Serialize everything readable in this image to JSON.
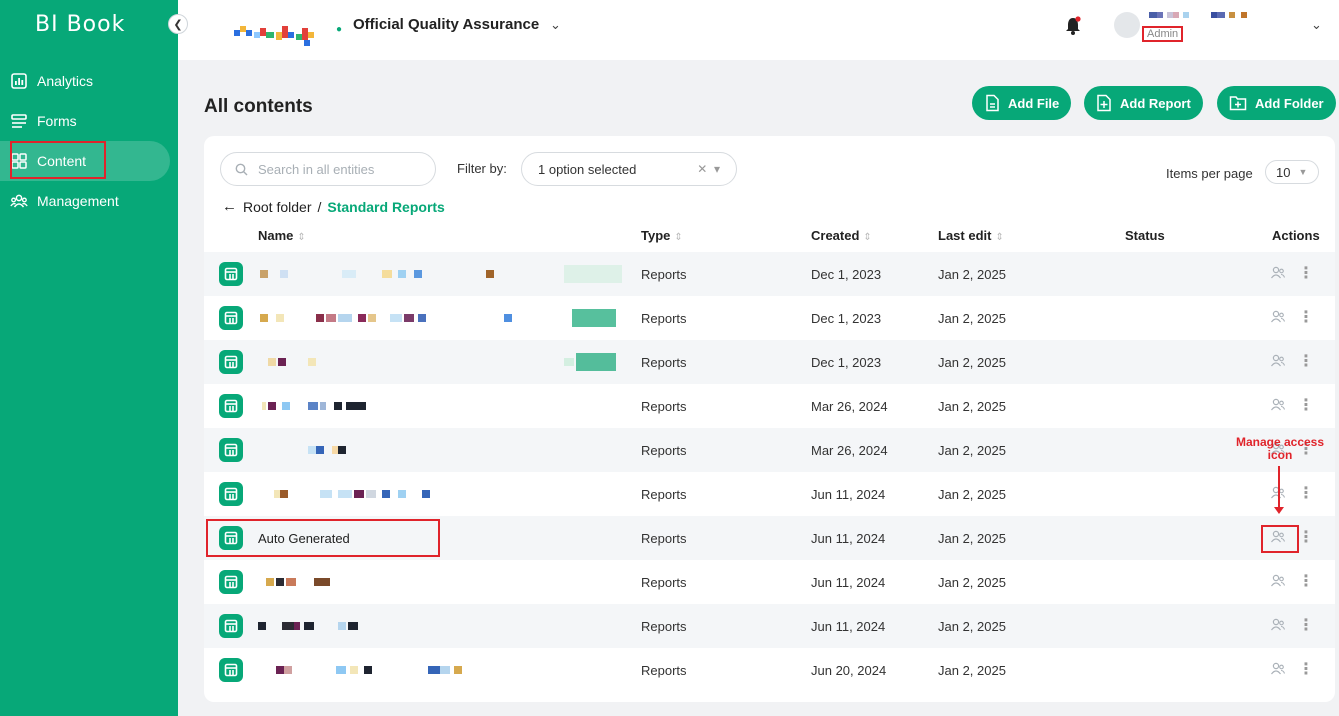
{
  "app": {
    "logo": "BI Book"
  },
  "sidebar": {
    "collapse_icon": "chevron-left-icon",
    "items": [
      {
        "label": "Analytics",
        "icon": "analytics-icon",
        "active": false
      },
      {
        "label": "Forms",
        "icon": "forms-icon",
        "active": false
      },
      {
        "label": "Content",
        "icon": "content-icon",
        "active": true
      },
      {
        "label": "Management",
        "icon": "management-icon",
        "active": false
      }
    ]
  },
  "topbar": {
    "org_name": "Official Quality Assurance",
    "user_role": "Admin",
    "notification_icon": "bell-icon"
  },
  "page": {
    "title": "All contents",
    "buttons": {
      "add_file": "Add File",
      "add_report": "Add Report",
      "add_folder": "Add Folder"
    }
  },
  "toolbar": {
    "search_placeholder": "Search in all entities",
    "filter_label": "Filter by:",
    "filter_value": "1 option selected",
    "items_per_page_label": "Items per page",
    "items_per_page_value": "10"
  },
  "breadcrumb": {
    "root": "Root folder",
    "separator": "/",
    "current": "Standard Reports"
  },
  "table": {
    "headers": {
      "name": "Name",
      "type": "Type",
      "created": "Created",
      "last_edit": "Last edit",
      "status": "Status",
      "actions": "Actions"
    },
    "rows": [
      {
        "name": "",
        "type": "Reports",
        "created": "Dec 1, 2023",
        "last_edit": "Jan 2, 2025",
        "status": ""
      },
      {
        "name": "",
        "type": "Reports",
        "created": "Dec 1, 2023",
        "last_edit": "Jan 2, 2025",
        "status": ""
      },
      {
        "name": "",
        "type": "Reports",
        "created": "Dec 1, 2023",
        "last_edit": "Jan 2, 2025",
        "status": ""
      },
      {
        "name": "",
        "type": "Reports",
        "created": "Mar 26, 2024",
        "last_edit": "Jan 2, 2025",
        "status": ""
      },
      {
        "name": "",
        "type": "Reports",
        "created": "Mar 26, 2024",
        "last_edit": "Jan 2, 2025",
        "status": ""
      },
      {
        "name": "",
        "type": "Reports",
        "created": "Jun 11, 2024",
        "last_edit": "Jan 2, 2025",
        "status": ""
      },
      {
        "name": "Auto Generated",
        "type": "Reports",
        "created": "Jun 11, 2024",
        "last_edit": "Jan 2, 2025",
        "status": ""
      },
      {
        "name": "",
        "type": "Reports",
        "created": "Jun 11, 2024",
        "last_edit": "Jan 2, 2025",
        "status": ""
      },
      {
        "name": "",
        "type": "Reports",
        "created": "Jun 11, 2024",
        "last_edit": "Jan 2, 2025",
        "status": ""
      },
      {
        "name": "",
        "type": "Reports",
        "created": "Jun 20, 2024",
        "last_edit": "Jan 2, 2025",
        "status": ""
      }
    ]
  },
  "annotation": {
    "line1": "Manage access",
    "line2": "icon"
  },
  "colors": {
    "brand": "#07a878",
    "highlight": "#e0242b"
  }
}
